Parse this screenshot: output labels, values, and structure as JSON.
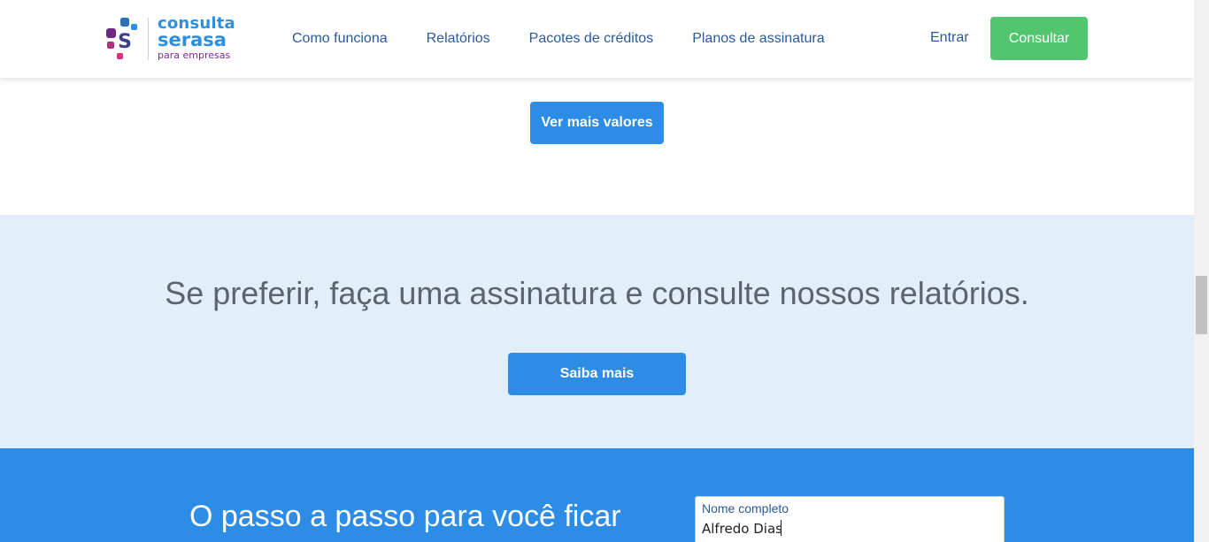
{
  "header": {
    "logo": {
      "line1": "consulta",
      "line2": "serasa",
      "line3": "para empresas",
      "mark_letter": "S"
    },
    "nav": [
      {
        "label": "Como funciona"
      },
      {
        "label": "Relatórios"
      },
      {
        "label": "Pacotes de créditos"
      },
      {
        "label": "Planos de assinatura"
      }
    ],
    "login_label": "Entrar",
    "cta_label": "Consultar"
  },
  "precos": {
    "button_label": "Ver mais valores"
  },
  "assinatura": {
    "title": "Se preferir, faça uma assinatura e consulte nossos relatórios.",
    "button_label": "Saiba mais"
  },
  "passo": {
    "title": "O passo a passo para você ficar",
    "form": {
      "name_label": "Nome completo",
      "name_value": "Alfredo Dias"
    }
  },
  "colors": {
    "primary_blue": "#2d8de6",
    "cta_green": "#52c56e",
    "light_blue_bg": "#e2effb",
    "nav_text": "#2a5a9a",
    "logo_purple": "#7a2a8a",
    "logo_pink": "#d6337a"
  }
}
